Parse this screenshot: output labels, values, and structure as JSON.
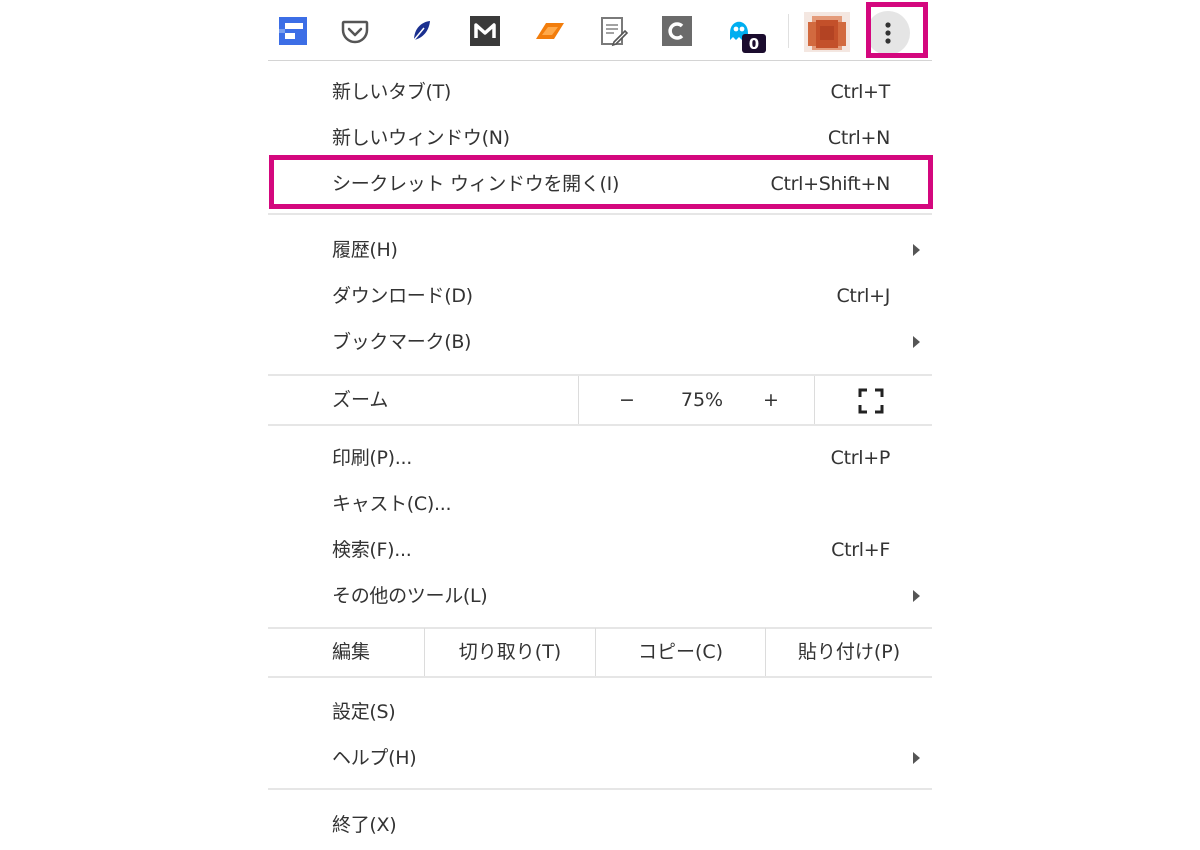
{
  "toolbar": {
    "extensions": [
      {
        "name": "blue-square-extension-icon"
      },
      {
        "name": "pocket-icon"
      },
      {
        "name": "blue-leaf-extension-icon"
      },
      {
        "name": "m-extension-icon"
      },
      {
        "name": "orange-flag-extension-icon"
      },
      {
        "name": "note-edit-icon"
      },
      {
        "name": "c-extension-icon"
      },
      {
        "name": "ghostery-icon",
        "badge": "0"
      }
    ],
    "menu_icon": "three-dots-vertical-icon",
    "highlight_color": "#d4077e"
  },
  "menu": {
    "new_tab": {
      "label": "新しいタブ(T)",
      "shortcut": "Ctrl+T"
    },
    "new_window": {
      "label": "新しいウィンドウ(N)",
      "shortcut": "Ctrl+N"
    },
    "incognito": {
      "label": "シークレット ウィンドウを開く(I)",
      "shortcut": "Ctrl+Shift+N"
    },
    "history": {
      "label": "履歴(H)"
    },
    "downloads": {
      "label": "ダウンロード(D)",
      "shortcut": "Ctrl+J"
    },
    "bookmarks": {
      "label": "ブックマーク(B)"
    },
    "zoom": {
      "label": "ズーム",
      "minus": "−",
      "value": "75%",
      "plus": "+",
      "fullscreen_icon": "fullscreen-icon"
    },
    "print": {
      "label": "印刷(P)...",
      "shortcut": "Ctrl+P"
    },
    "cast": {
      "label": "キャスト(C)..."
    },
    "find": {
      "label": "検索(F)...",
      "shortcut": "Ctrl+F"
    },
    "more_tools": {
      "label": "その他のツール(L)"
    },
    "edit": {
      "label": "編集",
      "cut": "切り取り(T)",
      "copy": "コピー(C)",
      "paste": "貼り付け(P)"
    },
    "settings": {
      "label": "設定(S)"
    },
    "help": {
      "label": "ヘルプ(H)"
    },
    "exit": {
      "label": "終了(X)"
    }
  }
}
